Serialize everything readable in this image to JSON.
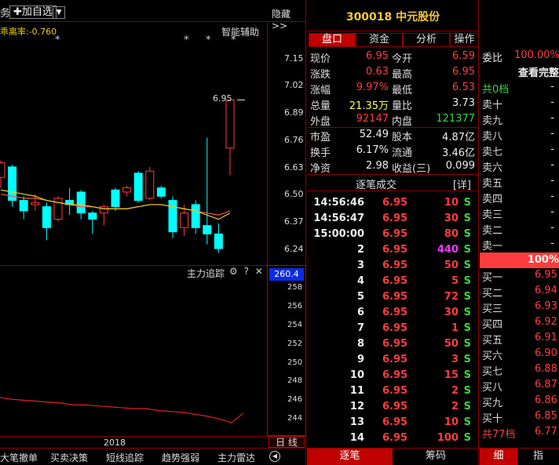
{
  "toolbar": {
    "left_glyph": "务",
    "add_label": "✚加自选",
    "dropdown_glyph": "▼",
    "hide_label": "隐藏>>",
    "indicator_text": "乖离率:-0.760",
    "smart_label": "智能辅助",
    "high_marker": "6.95",
    "stars": [
      "*",
      "*",
      "*",
      "*"
    ]
  },
  "price_axis": [
    "7.15",
    "7.02",
    "6.89",
    "6.76",
    "6.63",
    "6.50",
    "6.37",
    "6.24"
  ],
  "sub_chart": {
    "title": "主力追踪",
    "icons": [
      "⚙",
      "?",
      "✕"
    ],
    "current_value": "260.4",
    "axis": [
      "258",
      "256",
      "254",
      "252",
      "250",
      "248",
      "246",
      "244"
    ],
    "x_label": "2018",
    "period_label": "日 线"
  },
  "chart_data": {
    "type": "candlestick",
    "candles": [
      {
        "o": 6.58,
        "c": 6.65,
        "h": 6.66,
        "l": 6.53
      },
      {
        "o": 6.63,
        "c": 6.47,
        "h": 6.64,
        "l": 6.44
      },
      {
        "o": 6.47,
        "c": 6.42,
        "h": 6.49,
        "l": 6.38
      },
      {
        "o": 6.45,
        "c": 6.46,
        "h": 6.5,
        "l": 6.42
      },
      {
        "o": 6.44,
        "c": 6.34,
        "h": 6.46,
        "l": 6.28
      },
      {
        "o": 6.38,
        "c": 6.48,
        "h": 6.49,
        "l": 6.37
      },
      {
        "o": 6.47,
        "c": 6.45,
        "h": 6.53,
        "l": 6.4
      },
      {
        "o": 6.51,
        "c": 6.41,
        "h": 6.52,
        "l": 6.38
      },
      {
        "o": 6.41,
        "c": 6.38,
        "h": 6.42,
        "l": 6.31
      },
      {
        "o": 6.41,
        "c": 6.44,
        "h": 6.45,
        "l": 6.35
      },
      {
        "o": 6.52,
        "c": 6.44,
        "h": 6.53,
        "l": 6.42
      },
      {
        "o": 6.51,
        "c": 6.53,
        "h": 6.54,
        "l": 6.49
      },
      {
        "o": 6.6,
        "c": 6.47,
        "h": 6.61,
        "l": 6.46
      },
      {
        "o": 6.48,
        "c": 6.61,
        "h": 6.63,
        "l": 6.47
      },
      {
        "o": 6.53,
        "c": 6.49,
        "h": 6.54,
        "l": 6.48
      },
      {
        "o": 6.47,
        "c": 6.32,
        "h": 6.49,
        "l": 6.29
      },
      {
        "o": 6.34,
        "c": 6.41,
        "h": 6.45,
        "l": 6.3
      },
      {
        "o": 6.45,
        "c": 6.34,
        "h": 6.47,
        "l": 6.31
      },
      {
        "o": 6.35,
        "c": 6.31,
        "h": 6.77,
        "l": 6.26
      },
      {
        "o": 6.31,
        "c": 6.24,
        "h": 6.36,
        "l": 6.22
      },
      {
        "o": 6.72,
        "c": 6.95,
        "h": 6.95,
        "l": 6.59
      }
    ],
    "ma_yellow": [
      6.52,
      6.51,
      6.5,
      6.49,
      6.47,
      6.46,
      6.45,
      6.45,
      6.44,
      6.43,
      6.43,
      6.43,
      6.44,
      6.45,
      6.45,
      6.44,
      6.43,
      6.42,
      6.4,
      6.38,
      6.41
    ],
    "ma_red": [
      6.5,
      6.49,
      6.48,
      6.48,
      6.47,
      6.46,
      6.45,
      6.44,
      6.44,
      6.43,
      6.43,
      6.43,
      6.44,
      6.45,
      6.45,
      6.44,
      6.43,
      6.42,
      6.41,
      6.4,
      6.42
    ],
    "tracking_line": [
      246.2,
      246.0,
      245.9,
      245.8,
      245.7,
      245.6,
      245.4,
      245.4,
      245.3,
      245.2,
      245.1,
      245.0,
      245.0,
      244.8,
      244.7,
      244.6,
      244.4,
      244.2,
      243.9,
      243.5,
      244.5
    ],
    "ylim": [
      6.2,
      7.2
    ]
  },
  "bottom_tabs": [
    "大笔撤单",
    "买卖决策",
    "短线追踪",
    "趋势强弱",
    "主力雷达"
  ],
  "stock": {
    "code": "300018",
    "name": "中元股份"
  },
  "mid_tabs": [
    "盘口",
    "资金",
    "分析",
    "操作"
  ],
  "quote": [
    [
      "现价",
      "6.95",
      "今开",
      "6.59"
    ],
    [
      "涨跌",
      "0.63",
      "最高",
      "6.95"
    ],
    [
      "涨幅",
      "9.97%",
      "最低",
      "6.53"
    ],
    [
      "总量",
      "21.35万",
      "量比",
      "3.73"
    ],
    [
      "外盘",
      "92147",
      "内盘",
      "121377"
    ],
    [
      "市盈",
      "52.49",
      "股本",
      "4.87亿"
    ],
    [
      "换手",
      "6.17%",
      "流通",
      "3.46亿"
    ],
    [
      "净资",
      "2.98",
      "收益(三)",
      "0.099"
    ]
  ],
  "trades_header": {
    "title": "逐笔成交",
    "detail": "[详]"
  },
  "trades": [
    {
      "time": "14:56:46",
      "price": "6.95",
      "vol": "10",
      "side": "S"
    },
    {
      "time": "14:56:47",
      "price": "6.95",
      "vol": "30",
      "side": "S"
    },
    {
      "time": "15:00:00",
      "price": "6.95",
      "vol": "80",
      "side": "S"
    },
    {
      "time": "2",
      "price": "6.95",
      "vol": "440",
      "side": "S"
    },
    {
      "time": "3",
      "price": "6.95",
      "vol": "50",
      "side": "S"
    },
    {
      "time": "4",
      "price": "6.95",
      "vol": "5",
      "side": "S"
    },
    {
      "time": "5",
      "price": "6.95",
      "vol": "72",
      "side": "S"
    },
    {
      "time": "6",
      "price": "6.95",
      "vol": "30",
      "side": "S"
    },
    {
      "time": "7",
      "price": "6.95",
      "vol": "1",
      "side": "S"
    },
    {
      "time": "8",
      "price": "6.95",
      "vol": "50",
      "side": "S"
    },
    {
      "time": "9",
      "price": "6.95",
      "vol": "3",
      "side": "S"
    },
    {
      "time": "10",
      "price": "6.95",
      "vol": "15",
      "side": "S"
    },
    {
      "time": "11",
      "price": "6.95",
      "vol": "2",
      "side": "S"
    },
    {
      "time": "12",
      "price": "6.95",
      "vol": "2",
      "side": "S"
    },
    {
      "time": "13",
      "price": "6.95",
      "vol": "10",
      "side": "S"
    },
    {
      "time": "14",
      "price": "6.95",
      "vol": "100",
      "side": "S"
    }
  ],
  "mid_bottom": [
    "逐笔",
    "筹码"
  ],
  "order_book": {
    "weibi_label": "委比",
    "weibi_value": "100.00%",
    "view_all": "查看完整",
    "sell_total": "共0档",
    "sells": [
      "卖十",
      "卖九",
      "卖八",
      "卖七",
      "卖六",
      "卖五",
      "卖四",
      "卖三",
      "卖二",
      "卖一"
    ],
    "dash": "-",
    "bar_value": "100%",
    "buys": [
      {
        "label": "买一",
        "price": "6.95"
      },
      {
        "label": "买二",
        "price": "6.94"
      },
      {
        "label": "买三",
        "price": "6.93"
      },
      {
        "label": "买四",
        "price": "6.92"
      },
      {
        "label": "买五",
        "price": "6.91"
      },
      {
        "label": "买六",
        "price": "6.90"
      },
      {
        "label": "买七",
        "price": "6.88"
      },
      {
        "label": "买八",
        "price": "6.87"
      },
      {
        "label": "买九",
        "price": "6.86"
      },
      {
        "label": "买十",
        "price": "6.85"
      }
    ],
    "buy_total": "共77档",
    "buy_total_price": "6.77"
  },
  "right_bottom": [
    "细",
    "指"
  ]
}
